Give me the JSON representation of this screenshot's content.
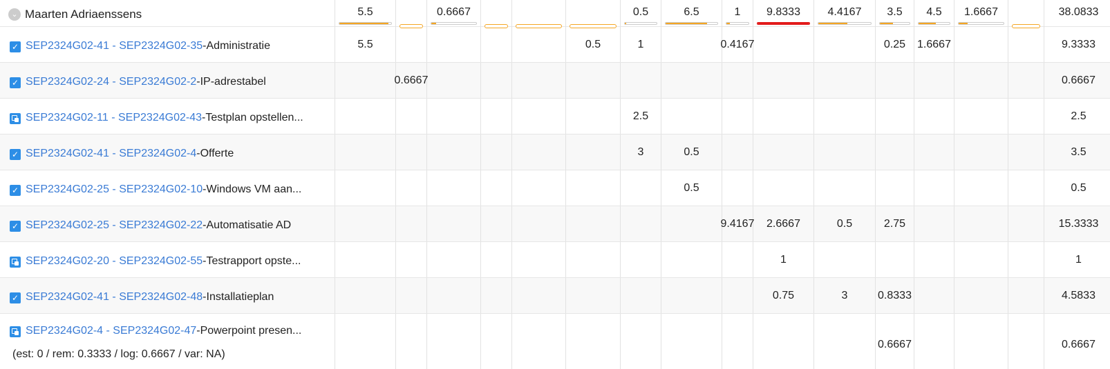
{
  "header": {
    "user": "Maarten Adriaenssens",
    "columns": [
      {
        "value": "5.5",
        "progress": 0.95,
        "state": "orange"
      },
      {
        "value": "",
        "progress": 0,
        "state": "empty"
      },
      {
        "value": "0.6667",
        "progress": 0.1,
        "state": "orange"
      },
      {
        "value": "",
        "progress": 0,
        "state": "empty"
      },
      {
        "value": "",
        "progress": 0,
        "state": "empty"
      },
      {
        "value": "",
        "progress": 0,
        "state": "empty"
      },
      {
        "value": "0.5",
        "progress": 0.05,
        "state": "orange"
      },
      {
        "value": "6.5",
        "progress": 0.8,
        "state": "orange"
      },
      {
        "value": "1",
        "progress": 0.15,
        "state": "orange"
      },
      {
        "value": "9.8333",
        "progress": 1.0,
        "state": "red"
      },
      {
        "value": "4.4167",
        "progress": 0.55,
        "state": "orange"
      },
      {
        "value": "3.5",
        "progress": 0.45,
        "state": "orange"
      },
      {
        "value": "4.5",
        "progress": 0.55,
        "state": "orange"
      },
      {
        "value": "1.6667",
        "progress": 0.2,
        "state": "orange"
      },
      {
        "value": "",
        "progress": 0,
        "state": "empty"
      },
      {
        "value": "38.0833",
        "progress": 0,
        "state": "none"
      }
    ]
  },
  "rows": [
    {
      "icon": "check",
      "link": "SEP2324G02-41 - SEP2324G02-35",
      "title": " -Administratie",
      "cells": [
        "5.5",
        "",
        "",
        "",
        "",
        "0.5",
        "1",
        "",
        "0.4167",
        "",
        "",
        "0.25",
        "1.6667",
        "",
        "9.3333"
      ]
    },
    {
      "icon": "check",
      "link": "SEP2324G02-24 - SEP2324G02-2",
      "title": " -IP-adrestabel",
      "cells": [
        "",
        "0.6667",
        "",
        "",
        "",
        "",
        "",
        "",
        "",
        "",
        "",
        "",
        "",
        "",
        "0.6667"
      ]
    },
    {
      "icon": "subtask",
      "link": "SEP2324G02-11 - SEP2324G02-43",
      "title": " -Testplan opstellen...",
      "cells": [
        "",
        "",
        "",
        "",
        "",
        "",
        "2.5",
        "",
        "",
        "",
        "",
        "",
        "",
        "",
        "2.5"
      ]
    },
    {
      "icon": "check",
      "link": "SEP2324G02-41 - SEP2324G02-4",
      "title": " -Offerte",
      "cells": [
        "",
        "",
        "",
        "",
        "",
        "",
        "3",
        "0.5",
        "",
        "",
        "",
        "",
        "",
        "",
        "3.5"
      ]
    },
    {
      "icon": "check",
      "link": "SEP2324G02-25 - SEP2324G02-10",
      "title": " -Windows VM aan...",
      "cells": [
        "",
        "",
        "",
        "",
        "",
        "",
        "",
        "0.5",
        "",
        "",
        "",
        "",
        "",
        "",
        "0.5"
      ]
    },
    {
      "icon": "check",
      "link": "SEP2324G02-25 - SEP2324G02-22",
      "title": " -Automatisatie AD",
      "cells": [
        "",
        "",
        "",
        "",
        "",
        "",
        "",
        "",
        "9.4167",
        "2.6667",
        "0.5",
        "2.75",
        "",
        "",
        "15.3333"
      ]
    },
    {
      "icon": "subtask",
      "link": "SEP2324G02-20 - SEP2324G02-55",
      "title": " -Testrapport opste...",
      "cells": [
        "",
        "",
        "",
        "",
        "",
        "",
        "",
        "",
        "",
        "1",
        "",
        "",
        "",
        "",
        "1"
      ]
    },
    {
      "icon": "check",
      "link": "SEP2324G02-41 - SEP2324G02-48",
      "title": " -Installatieplan",
      "cells": [
        "",
        "",
        "",
        "",
        "",
        "",
        "",
        "",
        "",
        "0.75",
        "3",
        "0.8333",
        "",
        "",
        "4.5833"
      ]
    },
    {
      "icon": "subtask",
      "link": "SEP2324G02-4 - SEP2324G02-47",
      "title": " -Powerpoint presen...",
      "info": "(est: 0 / rem: 0.3333 / log: 0.6667 / var: NA)",
      "cells": [
        "",
        "",
        "",
        "",
        "",
        "",
        "",
        "",
        "",
        "",
        "",
        "0.6667",
        "",
        "",
        "0.6667"
      ]
    }
  ]
}
